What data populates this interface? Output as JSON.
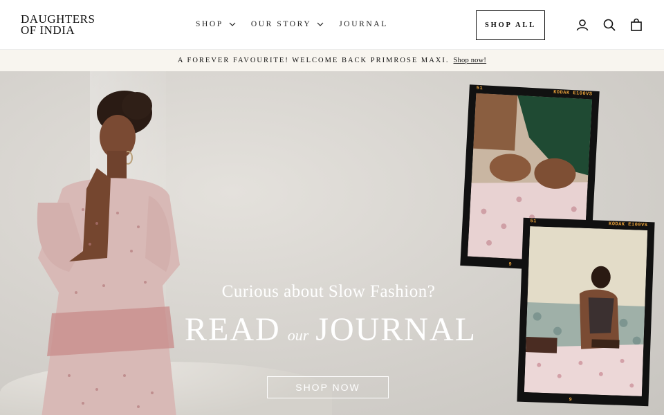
{
  "brand": {
    "line1": "DAUGHTERS",
    "line2": "OF INDIA"
  },
  "nav": {
    "items": [
      {
        "label": "SHOP",
        "has_dropdown": true
      },
      {
        "label": "OUR STORY",
        "has_dropdown": true
      },
      {
        "label": "JOURNAL",
        "has_dropdown": false
      }
    ],
    "shop_all": "SHOP ALL",
    "icons": [
      "account-icon",
      "search-icon",
      "cart-icon"
    ]
  },
  "announcement": {
    "text": "A FOREVER FAVOURITE! WELCOME BACK PRIMROSE MAXI.",
    "link": "Shop now!"
  },
  "hero": {
    "subtitle": "Curious about Slow Fashion?",
    "title_left": "READ",
    "title_mid": "our",
    "title_right": "JOURNAL",
    "button": "SHOP NOW"
  },
  "photos": [
    {
      "label": "KODAK  E100VS",
      "frame_top": "51",
      "frame_bottom": "9"
    },
    {
      "label": "KODAK  E100VS",
      "frame_top": "51",
      "frame_bottom": "9"
    }
  ],
  "colors": {
    "announcement_bg": "#f8f5ef",
    "film_text": "#e8a13a",
    "hero_bg": "#d7d4cf"
  }
}
